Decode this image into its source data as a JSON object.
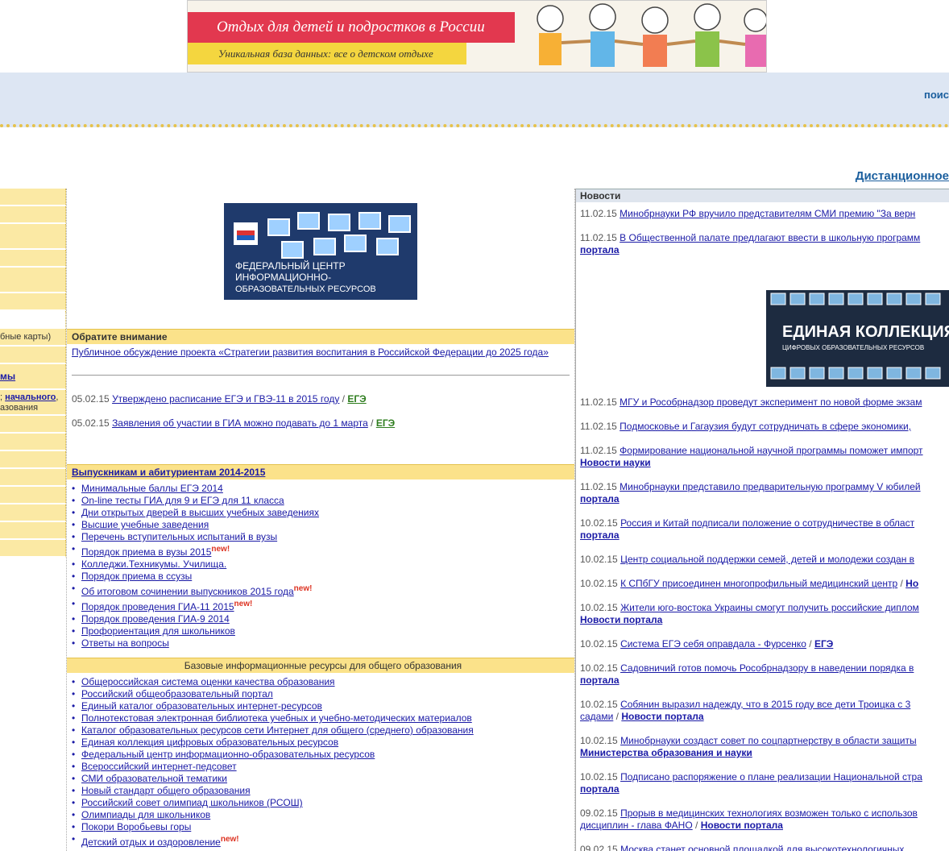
{
  "banner": {
    "title": "Отдых для детей и подростков в России",
    "subtitle": "Уникальная база данных: все о детском отдыхе"
  },
  "nav": {
    "search_text": "поис"
  },
  "distance_link": "Дистанционное",
  "sidebar": {
    "item_cards": "бные карты)",
    "item_mы": "мы",
    "item_start_link": "начального",
    "item_start_prefix": "; ",
    "item_start_suffix": ",",
    "item_education": "азования"
  },
  "fcior": {
    "line1": "ФЕДЕРАЛЬНЫЙ ЦЕНТР",
    "line2": "ИНФОРМАЦИОННО-",
    "line3": "ОБРАЗОВАТЕЛЬНЫХ РЕСУРСОВ"
  },
  "attention": {
    "header": "Обратите внимание",
    "lead_link": "Публичное обсуждение проекта «Стратегии развития воспитания в Российской Федерации до 2025 года»",
    "items": [
      {
        "date": "05.02.15",
        "text": "Утверждено расписание ЕГЭ и ГВЭ-11 в 2015 году",
        "tag": "ЕГЭ"
      },
      {
        "date": "05.02.15",
        "text": "Заявления об участии в ГИА можно подавать до 1 марта",
        "tag": "ЕГЭ"
      }
    ]
  },
  "graduates": {
    "header": "Выпускникам и абитуриентам 2014-2015",
    "new_label": "new!",
    "items": [
      {
        "text": "Минимальные баллы ЕГЭ 2014",
        "new": false
      },
      {
        "text": "On-line тесты ГИА для 9 и ЕГЭ для 11 класса",
        "new": false
      },
      {
        "text": "Дни открытых дверей в высших учебных заведениях",
        "new": false
      },
      {
        "text": "Высшие учебные заведения",
        "new": false
      },
      {
        "text": "Перечень вступительных испытаний в вузы",
        "new": false
      },
      {
        "text": "Порядок приема в вузы 2015",
        "new": true
      },
      {
        "text": "Колледжи.Техникумы. Училища.",
        "new": false
      },
      {
        "text": "Порядок приема в ссузы",
        "new": false
      },
      {
        "text": "Об итоговом сочинении выпускников 2015 года",
        "new": true
      },
      {
        "text": "Порядок проведения ГИА-11 2015",
        "new": true
      },
      {
        "text": "Порядок проведения ГИА-9 2014",
        "new": false
      },
      {
        "text": "Профориентация для школьников",
        "new": false
      },
      {
        "text": "Ответы на вопросы",
        "new": false
      }
    ]
  },
  "resources": {
    "header": "Базовые информационные ресурсы для общего образования",
    "items": [
      {
        "text": "Общероссийская система оценки качества образования",
        "new": false
      },
      {
        "text": "Российский общеобразовательный портал",
        "new": false
      },
      {
        "text": "Единый каталог образовательных интернет-ресурсов",
        "new": false
      },
      {
        "text": "Полнотекстовая электронная библиотека учебных и учебно-методических материалов",
        "new": false
      },
      {
        "text": "Каталог образовательных ресурсов сети Интернет для общего (среднего) образования",
        "new": false
      },
      {
        "text": "Единая коллекция цифровых образовательных ресурсов",
        "new": false
      },
      {
        "text": "Федеральный центр информационно-образовательных ресурсов",
        "new": false
      },
      {
        "text": "Всероссийский интернет-педсовет",
        "new": false
      },
      {
        "text": "СМИ образовательной тематики",
        "new": false
      },
      {
        "text": "Новый стандарт общего образования",
        "new": false
      },
      {
        "text": "Российский совет олимпиад школьников (РСОШ)",
        "new": false
      },
      {
        "text": "Олимпиады для школьников",
        "new": false
      },
      {
        "text": "Покори Воробьевы горы",
        "new": false
      },
      {
        "text": "Детский отдых и оздоровление",
        "new": true
      }
    ]
  },
  "news": {
    "header": "Новости",
    "top": [
      {
        "date": "11.02.15",
        "text": "Минобрнауки РФ вручило представителям СМИ премию \"За верн",
        "tag": ""
      },
      {
        "date": "11.02.15",
        "text": "В Общественной палате предлагают ввести в школьную программ",
        "tag": "портала"
      }
    ],
    "collection_banner": {
      "title": "ЕДИНАЯ КОЛЛЕКЦИЯ",
      "subtitle": "ЦИФРОВЫХ ОБРАЗОВАТЕЛЬНЫХ РЕСУРСОВ"
    },
    "items": [
      {
        "date": "11.02.15",
        "text": "МГУ и Рособрнадзор проведут эксперимент по новой форме экзам",
        "tag": ""
      },
      {
        "date": "11.02.15",
        "text": "Подмосковье и Гагаузия будут сотрудничать в сфере экономики,",
        "tag": ""
      },
      {
        "date": "11.02.15",
        "text": "Формирование национальной научной программы поможет импорт",
        "tag": "Новости науки"
      },
      {
        "date": "11.02.15",
        "text": "Минобрнауки представило предварительную программу V юбилей",
        "tag": "портала"
      },
      {
        "date": "10.02.15",
        "text": "Россия и Китай подписали положение о сотрудничестве в област",
        "tag": "портала"
      },
      {
        "date": "10.02.15",
        "text": "Центр социальной поддержки семей, детей и молодежи создан в",
        "tag": ""
      },
      {
        "date": "10.02.15",
        "text": "К СПбГУ присоединен многопрофильный медицинский центр",
        "tag": "Но",
        "inline": true
      },
      {
        "date": "10.02.15",
        "text": "Жители юго-востока Украины смогут получить российские диплом",
        "tag": "Новости портала"
      },
      {
        "date": "10.02.15",
        "text": "Система ЕГЭ себя оправдала - Фурсенко",
        "tag": "ЕГЭ",
        "inline": true
      },
      {
        "date": "10.02.15",
        "text": "Садовничий готов помочь Рособрнадзору в наведении порядка в",
        "tag": "портала"
      },
      {
        "date": "10.02.15",
        "text": "Собянин выразил надежду, что в 2015 году все дети Троицка с 3",
        "line2": "садами",
        "tag": "Новости портала"
      },
      {
        "date": "10.02.15",
        "text": "Минобрнауки создаст совет по соцпартнерству в области защиты",
        "tag": "Министерства образования и науки"
      },
      {
        "date": "10.02.15",
        "text": "Подписано распоряжение о плане реализации Национальной стра",
        "tag": "портала"
      },
      {
        "date": "09.02.15",
        "text": "Прорыв в медицинских технологиях возможен только с использов",
        "line2": "дисциплин - глава ФАНО",
        "tag": "Новости портала"
      },
      {
        "date": "09.02.15",
        "text": "Москва станет основной площадкой для высокотехнологичных",
        "tag": ""
      }
    ]
  },
  "colors": {
    "yellow": "#fbe28a",
    "nav_blue": "#dde6f3",
    "link": "#1a1aa6",
    "tag_green": "#2e7d1e"
  }
}
